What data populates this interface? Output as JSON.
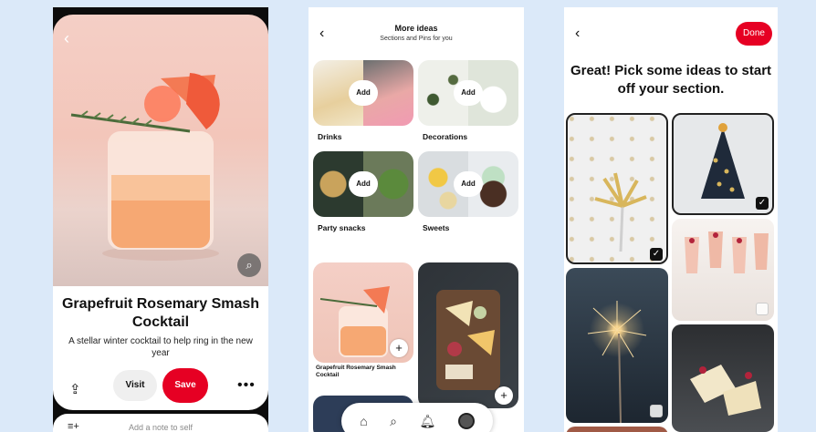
{
  "pin_detail": {
    "title": "Grapefruit Rosemary Smash Cocktail",
    "description": "A stellar winter cocktail to help ring in the new year",
    "visit_label": "Visit",
    "save_label": "Save",
    "note_placeholder": "Add a note to self"
  },
  "more_ideas": {
    "title": "More ideas",
    "subtitle": "Sections and Pins for you",
    "add_label": "Add",
    "sections": [
      {
        "label": "Drinks"
      },
      {
        "label": "Decorations"
      },
      {
        "label": "Party snacks"
      },
      {
        "label": "Sweets"
      }
    ],
    "pins": [
      {
        "label": "Grapefruit Rosemary Smash Cocktail"
      }
    ]
  },
  "pick_ideas": {
    "done_label": "Done",
    "headline": "Great! Pick some ideas to start off your section."
  },
  "colors": {
    "brand_red": "#e60023",
    "background": "#dbe9f9"
  }
}
